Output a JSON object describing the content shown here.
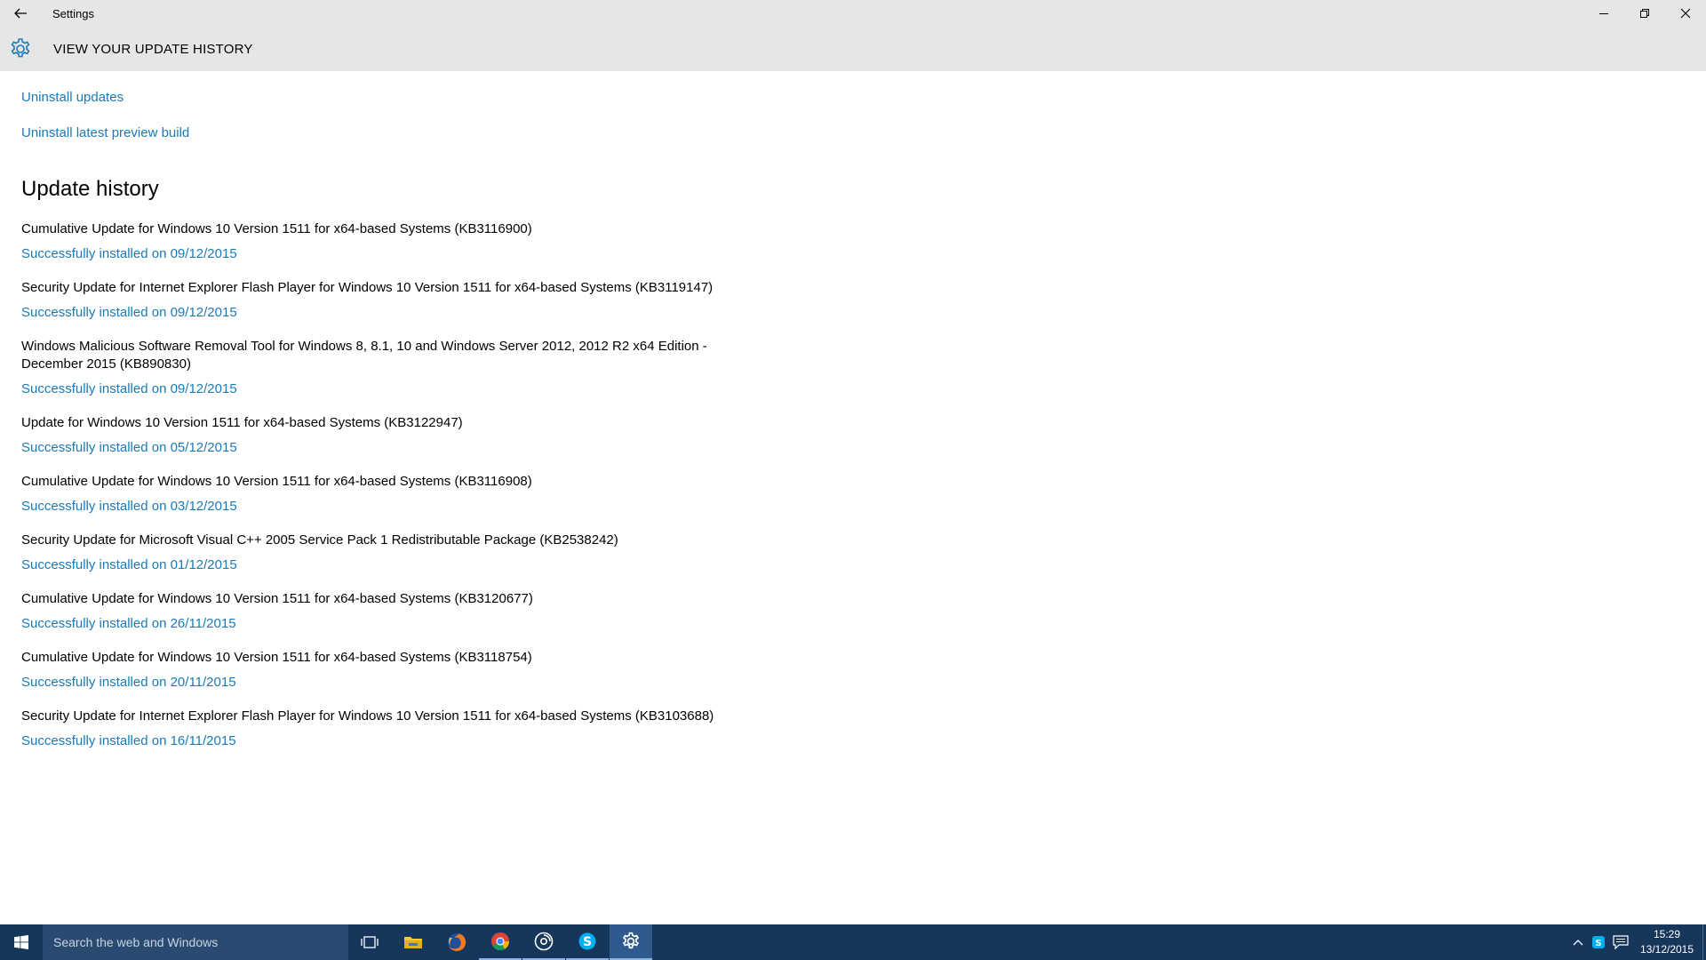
{
  "window": {
    "app_title": "Settings"
  },
  "header": {
    "page_title": "VIEW YOUR UPDATE HISTORY"
  },
  "links": {
    "uninstall_updates": "Uninstall updates",
    "uninstall_preview": "Uninstall latest preview build"
  },
  "history": {
    "title": "Update history",
    "items": [
      {
        "name": "Cumulative Update for Windows 10 Version 1511 for x64-based Systems (KB3116900)",
        "status": "Successfully installed on 09/12/2015"
      },
      {
        "name": "Security Update for Internet Explorer Flash Player for Windows 10 Version 1511 for x64-based Systems (KB3119147)",
        "status": "Successfully installed on 09/12/2015"
      },
      {
        "name": "Windows Malicious Software Removal Tool for Windows 8, 8.1, 10 and Windows Server 2012, 2012 R2 x64 Edition - December 2015 (KB890830)",
        "status": "Successfully installed on 09/12/2015"
      },
      {
        "name": "Update for Windows 10 Version 1511 for x64-based Systems (KB3122947)",
        "status": "Successfully installed on 05/12/2015"
      },
      {
        "name": "Cumulative Update for Windows 10 Version 1511 for x64-based Systems (KB3116908)",
        "status": "Successfully installed on 03/12/2015"
      },
      {
        "name": "Security Update for Microsoft Visual C++ 2005 Service Pack 1 Redistributable Package (KB2538242)",
        "status": "Successfully installed on 01/12/2015"
      },
      {
        "name": "Cumulative Update for Windows 10 Version 1511 for x64-based Systems (KB3120677)",
        "status": "Successfully installed on 26/11/2015"
      },
      {
        "name": "Cumulative Update for Windows 10 Version 1511 for x64-based Systems (KB3118754)",
        "status": "Successfully installed on 20/11/2015"
      },
      {
        "name": "Security Update for Internet Explorer Flash Player for Windows 10 Version 1511 for x64-based Systems (KB3103688)",
        "status": "Successfully installed on 16/11/2015"
      }
    ]
  },
  "taskbar": {
    "search_placeholder": "Search the web and Windows",
    "apps": [
      "task-view-icon",
      "file-explorer-icon",
      "firefox-icon",
      "chrome-icon",
      "groove-music-icon",
      "skype-icon",
      "settings-icon"
    ],
    "clock_time": "15:29",
    "clock_date": "13/12/2015"
  },
  "colors": {
    "accent": "#1a7ab9",
    "titlebar_bg": "#e6e6e6",
    "taskbar_bg": "#16365c",
    "search_bg": "#2b4a72"
  }
}
